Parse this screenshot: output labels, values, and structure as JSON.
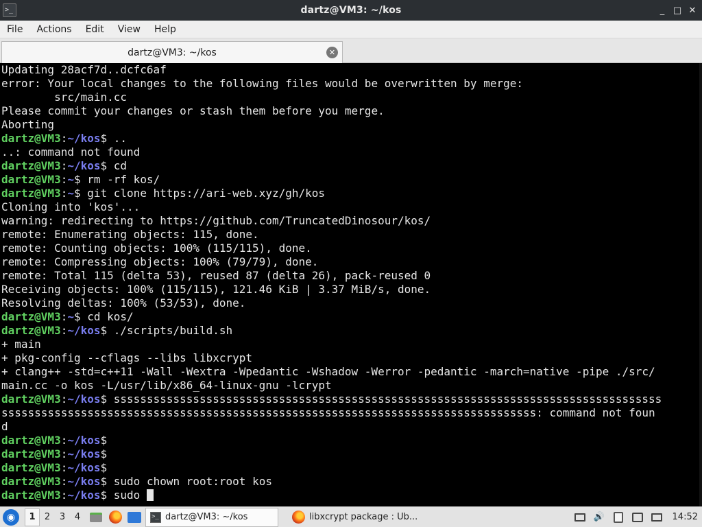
{
  "window": {
    "title": "dartz@VM3: ~/kos",
    "app_icon": "terminal-icon",
    "controls": [
      "_",
      "□",
      "✕"
    ]
  },
  "menubar": {
    "items": [
      "File",
      "Actions",
      "Edit",
      "View",
      "Help"
    ]
  },
  "tabs": [
    {
      "label": "dartz@VM3: ~/kos",
      "close": "✕"
    }
  ],
  "prompt": {
    "user_host": "dartz@VM3",
    "colon": ":",
    "dollar": "$ "
  },
  "terminal_lines": [
    {
      "type": "out",
      "text": "Updating 28acf7d..dcfc6af"
    },
    {
      "type": "out",
      "text": "error: Your local changes to the following files would be overwritten by merge:"
    },
    {
      "type": "out",
      "text": "        src/main.cc"
    },
    {
      "type": "out",
      "text": "Please commit your changes or stash them before you merge."
    },
    {
      "type": "out",
      "text": "Aborting"
    },
    {
      "type": "cmd",
      "path": "~/kos",
      "cmd": ".."
    },
    {
      "type": "out",
      "text": "..: command not found"
    },
    {
      "type": "cmd",
      "path": "~/kos",
      "cmd": "cd"
    },
    {
      "type": "cmd",
      "path": "~",
      "cmd": "rm -rf kos/"
    },
    {
      "type": "cmd",
      "path": "~",
      "cmd": "git clone https://ari-web.xyz/gh/kos"
    },
    {
      "type": "out",
      "text": "Cloning into 'kos'..."
    },
    {
      "type": "out",
      "text": "warning: redirecting to https://github.com/TruncatedDinosour/kos/"
    },
    {
      "type": "out",
      "text": "remote: Enumerating objects: 115, done."
    },
    {
      "type": "out",
      "text": "remote: Counting objects: 100% (115/115), done."
    },
    {
      "type": "out",
      "text": "remote: Compressing objects: 100% (79/79), done."
    },
    {
      "type": "out",
      "text": "remote: Total 115 (delta 53), reused 87 (delta 26), pack-reused 0"
    },
    {
      "type": "out",
      "text": "Receiving objects: 100% (115/115), 121.46 KiB | 3.37 MiB/s, done."
    },
    {
      "type": "out",
      "text": "Resolving deltas: 100% (53/53), done."
    },
    {
      "type": "cmd",
      "path": "~",
      "cmd": "cd kos/"
    },
    {
      "type": "cmd",
      "path": "~/kos",
      "cmd": "./scripts/build.sh"
    },
    {
      "type": "out",
      "text": "+ main"
    },
    {
      "type": "out",
      "text": "+ pkg-config --cflags --libs libxcrypt"
    },
    {
      "type": "out",
      "text": "+ clang++ -std=c++11 -Wall -Wextra -Wpedantic -Wshadow -Werror -pedantic -march=native -pipe ./src/"
    },
    {
      "type": "out",
      "text": "main.cc -o kos -L/usr/lib/x86_64-linux-gnu -lcrypt"
    },
    {
      "type": "cmd",
      "path": "~/kos",
      "cmd": "sssssssssssssssssssssssssssssssssssssssssssssssssssssssssssssssssssssssssssssssssss"
    },
    {
      "type": "out",
      "text": "sssssssssssssssssssssssssssssssssssssssssssssssssssssssssssssssssssssssssssssssss: command not foun"
    },
    {
      "type": "out",
      "text": "d"
    },
    {
      "type": "cmd",
      "path": "~/kos",
      "cmd": ""
    },
    {
      "type": "cmd",
      "path": "~/kos",
      "cmd": ""
    },
    {
      "type": "cmd",
      "path": "~/kos",
      "cmd": ""
    },
    {
      "type": "cmd",
      "path": "~/kos",
      "cmd": "sudo chown root:root kos"
    },
    {
      "type": "cmd",
      "path": "~/kos",
      "cmd": "sudo ",
      "cursor": true
    }
  ],
  "taskbar": {
    "start_icon": "start-menu-icon",
    "workspaces": [
      "1",
      "2",
      "3",
      "4"
    ],
    "active_workspace": "1",
    "launchers": [
      "file-manager-icon",
      "firefox-icon",
      "show-desktop-icon"
    ],
    "tasks": [
      {
        "label": "dartz@VM3: ~/kos",
        "icon": "terminal-icon",
        "active": true
      },
      {
        "label": "libxcrypt package : Ub...",
        "icon": "firefox-icon",
        "active": false
      }
    ],
    "tray_icons": [
      "display-icon",
      "volume-icon",
      "clipboard-icon",
      "network-icon",
      "notification-icon"
    ],
    "volume_glyph": "🔊",
    "clock": "14:52"
  }
}
